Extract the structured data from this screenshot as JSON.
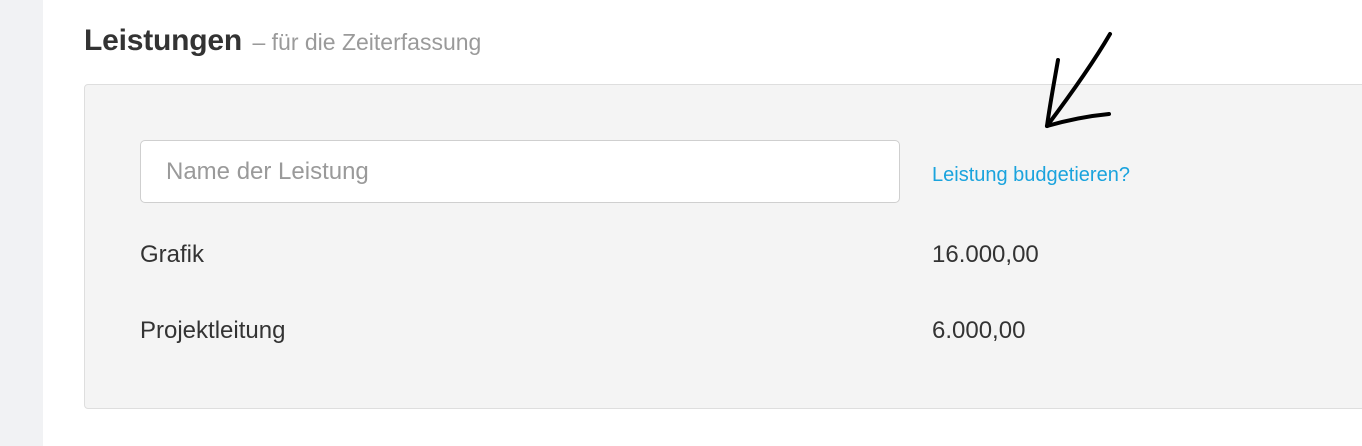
{
  "heading": {
    "title": "Leistungen",
    "subtitle": "– für die Zeiterfassung"
  },
  "form": {
    "name_placeholder": "Name der Leistung",
    "name_value": "",
    "budget_link_label": "Leistung budgetieren?"
  },
  "services": [
    {
      "name": "Grafik",
      "value": "16.000,00"
    },
    {
      "name": "Projektleitung",
      "value": "6.000,00"
    }
  ],
  "annotation": {
    "icon": "hand-drawn-arrow-icon",
    "color": "#000000"
  },
  "colors": {
    "link": "#1aa3dd",
    "panel_background": "#f4f4f4",
    "text": "#333333",
    "muted_text": "#9a9a9a"
  }
}
